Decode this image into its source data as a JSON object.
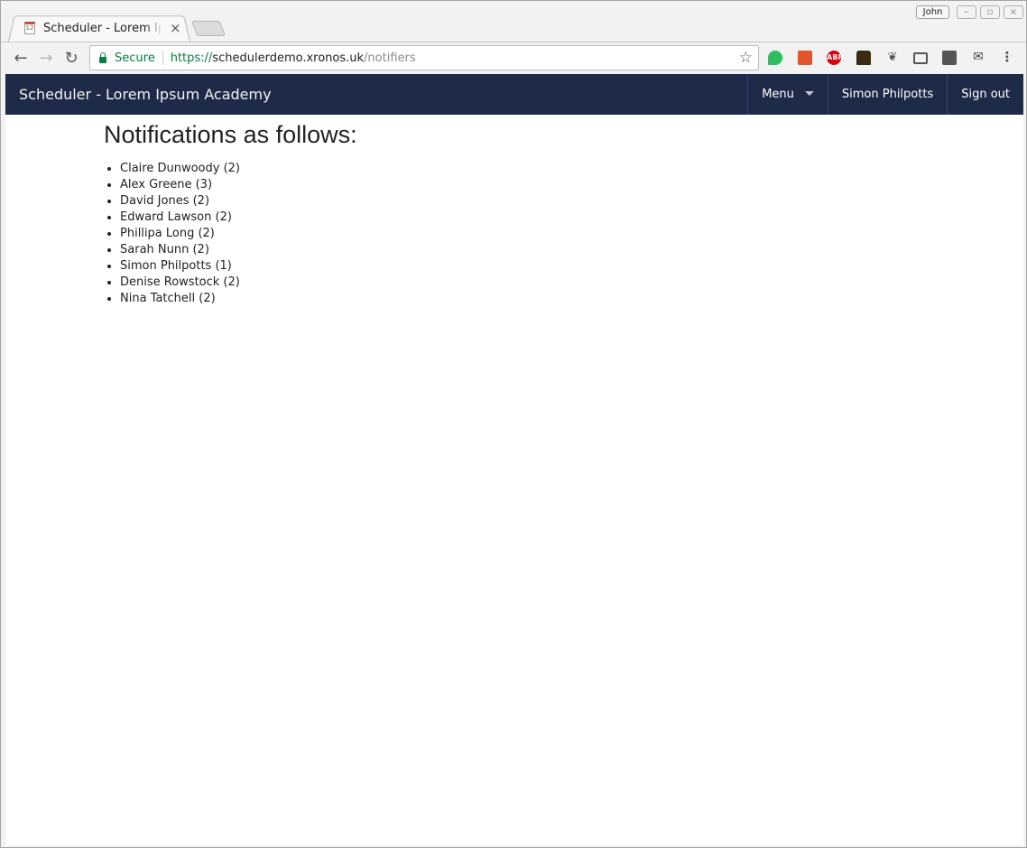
{
  "browser": {
    "tab_title": "Scheduler - Lorem Ipsum Academy",
    "tab_close": "×",
    "profile_name": "John",
    "url_secure_label": "Secure",
    "url_scheme": "https://",
    "url_host": "schedulerdemo.xronos.uk",
    "url_path": "/notifiers",
    "extensions": [
      "evernote-icon",
      "office-icon",
      "adblock-icon",
      "wallet-icon",
      "paw-icon",
      "cast-icon",
      "keep-icon",
      "mail-check-icon"
    ],
    "abp_label": "ABP"
  },
  "navbar": {
    "brand": "Scheduler - Lorem Ipsum Academy",
    "menu_label": "Menu",
    "user_label": "Simon Philpotts",
    "signout_label": "Sign out"
  },
  "main": {
    "heading": "Notifications as follows:",
    "items": [
      "Claire Dunwoody (2)",
      "Alex Greene (3)",
      "David Jones (2)",
      "Edward Lawson (2)",
      "Phillipa Long (2)",
      "Sarah Nunn (2)",
      "Simon Philpotts (1)",
      "Denise Rowstock (2)",
      "Nina Tatchell (2)"
    ]
  },
  "colors": {
    "navbar_bg": "#1e2b48",
    "secure_green": "#0b8043"
  }
}
